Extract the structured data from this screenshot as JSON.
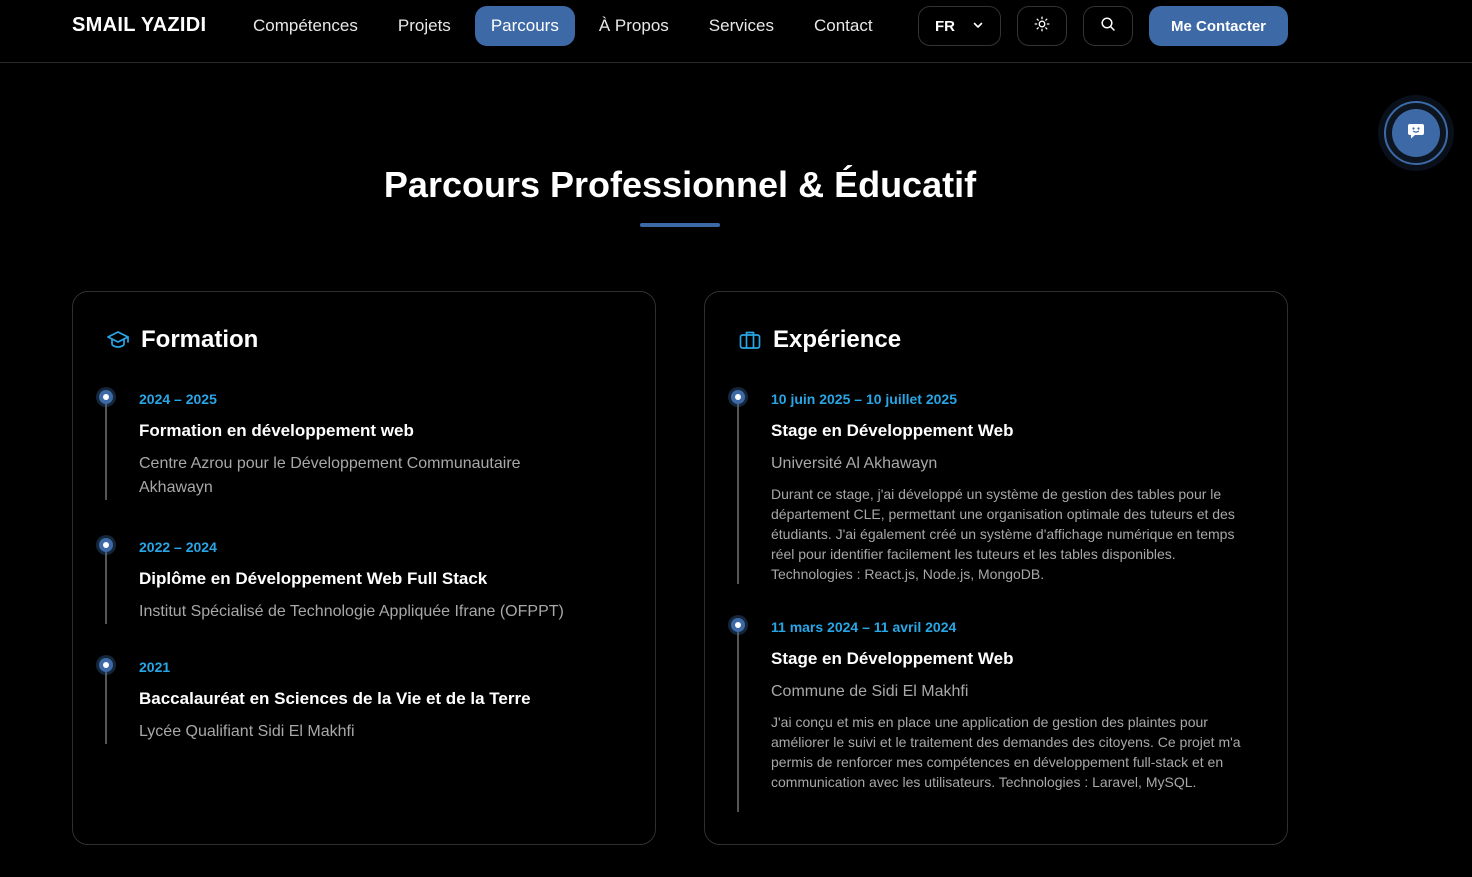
{
  "header": {
    "brand": "SMAIL YAZIDI",
    "nav": [
      "Compétences",
      "Projets",
      "Parcours",
      "À Propos",
      "Services",
      "Contact"
    ],
    "active_nav": "Parcours",
    "language": "FR",
    "cta_label": "Me Contacter"
  },
  "section": {
    "title": "Parcours Professionnel & Éducatif"
  },
  "formation": {
    "heading": "Formation",
    "items": [
      {
        "date": "2024 – 2025",
        "title": "Formation en développement web",
        "org": "Centre Azrou pour le Développement Communautaire Akhawayn"
      },
      {
        "date": "2022 – 2024",
        "title": "Diplôme en Développement Web Full Stack",
        "org": "Institut Spécialisé de Technologie Appliquée Ifrane (OFPPT)"
      },
      {
        "date": "2021",
        "title": "Baccalauréat en Sciences de la Vie et de la Terre",
        "org": "Lycée Qualifiant Sidi El Makhfi"
      }
    ]
  },
  "experience": {
    "heading": "Expérience",
    "items": [
      {
        "date": "10 juin 2025 – 10 juillet 2025",
        "title": "Stage en Développement Web",
        "org": "Université Al Akhawayn",
        "desc": "Durant ce stage, j'ai développé un système de gestion des tables pour le département CLE, permettant une organisation optimale des tuteurs et des étudiants. J'ai également créé un système d'affichage numérique en temps réel pour identifier facilement les tuteurs et les tables disponibles. Technologies : React.js, Node.js, MongoDB."
      },
      {
        "date": "11 mars 2024 – 11 avril 2024",
        "title": "Stage en Développement Web",
        "org": "Commune de Sidi El Makhfi",
        "desc": "J'ai conçu et mis en place une application de gestion des plaintes pour améliorer le suivi et le traitement des demandes des citoyens. Ce projet m'a permis de renforcer mes compétences en développement full-stack et en communication avec les utilisateurs. Technologies : Laravel, MySQL."
      }
    ]
  },
  "colors": {
    "accent": "#3d6aa6",
    "date": "#29a6e6",
    "background": "#000000"
  },
  "icons": [
    "chevron-down-icon",
    "sun-icon",
    "search-icon",
    "chat-bot-icon",
    "graduation-cap-icon",
    "briefcase-icon"
  ]
}
